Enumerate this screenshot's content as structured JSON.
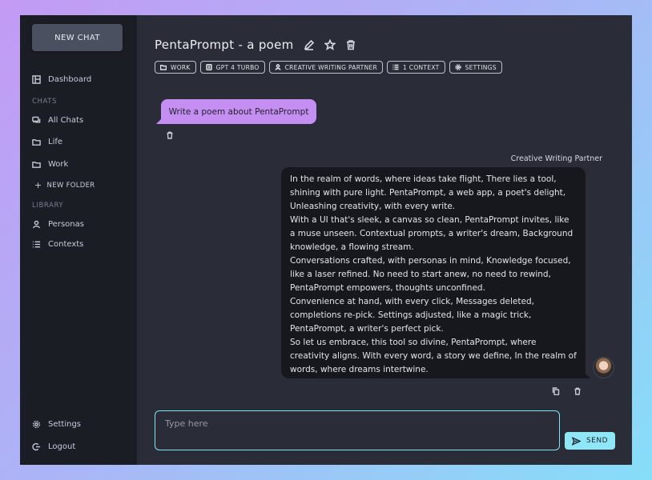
{
  "sidebar": {
    "new_chat_label": "NEW CHAT",
    "dashboard_label": "Dashboard",
    "chats_section": "CHATS",
    "all_chats_label": "All Chats",
    "folders": [
      {
        "label": "Life"
      },
      {
        "label": "Work"
      }
    ],
    "new_folder_label": "NEW FOLDER",
    "library_section": "LIBRARY",
    "personas_label": "Personas",
    "contexts_label": "Contexts",
    "settings_label": "Settings",
    "logout_label": "Logout"
  },
  "header": {
    "title": "PentaPrompt - a poem",
    "tags": [
      {
        "icon": "folder-icon",
        "label": "WORK"
      },
      {
        "icon": "model-icon",
        "label": "GPT 4 TURBO"
      },
      {
        "icon": "person-icon",
        "label": "CREATIVE WRITING PARTNER"
      },
      {
        "icon": "list-icon",
        "label": "1 CONTEXT"
      },
      {
        "icon": "gear-icon",
        "label": "SETTINGS"
      }
    ]
  },
  "conversation": {
    "user_message": "Write a poem about PentaPrompt",
    "persona_name": "Creative Writing Partner",
    "ai_paragraphs": [
      "In the realm of words, where ideas take flight, There lies a tool, shining with pure light. PentaPrompt, a web app, a poet's delight, Unleashing creativity, with every write.",
      "With a UI that's sleek, a canvas so clean, PentaPrompt invites, like a muse unseen. Contextual prompts, a writer's dream, Background knowledge, a flowing stream.",
      "Conversations crafted, with personas in mind, Knowledge focused, like a laser refined. No need to start anew, no need to rewind, PentaPrompt empowers, thoughts unconfined.",
      "Convenience at hand, with every click, Messages deleted, completions re-pick. Settings adjusted, like a magic trick, PentaPrompt, a writer's perfect pick.",
      "So let us embrace, this tool so divine, PentaPrompt, where creativity aligns. With every word, a story we define, In the realm of words, where dreams intertwine."
    ]
  },
  "composer": {
    "placeholder": "Type here",
    "send_label": "SEND"
  },
  "colors": {
    "accent": "#8ee6f6",
    "user_bubble": "#c58ef2",
    "sidebar_bg": "#1b1d24",
    "main_bg": "#2a2d37"
  }
}
